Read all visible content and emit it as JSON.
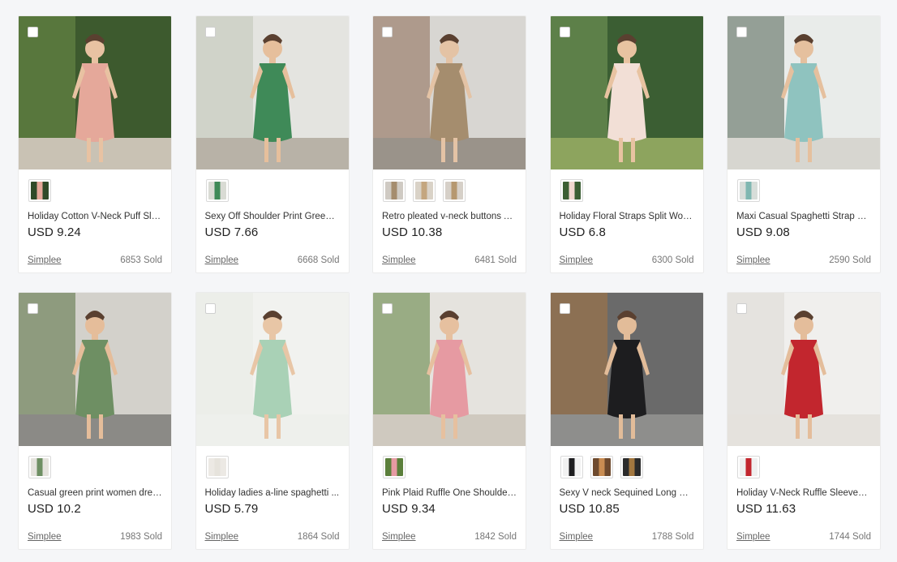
{
  "products": [
    {
      "title": "Holiday Cotton V-Neck Puff Sle...",
      "price": "USD 9.24",
      "store": "Simplee",
      "sold": "6853 Sold",
      "colors": {
        "bg": "#3d5a2e",
        "bg2": "#6f8f4a",
        "ground": "#c9c2b4",
        "dress": "#e5a89a",
        "skin": "#e8c2a2"
      },
      "swatches": [
        {
          "a": "#2f4a28",
          "b": "#e5a89a"
        }
      ]
    },
    {
      "title": "Sexy Off Shoulder Print Green ...",
      "price": "USD 7.66",
      "store": "Simplee",
      "sold": "6668 Sold",
      "colors": {
        "bg": "#e4e4e0",
        "bg2": "#bfc4b6",
        "ground": "#b8b2a7",
        "dress": "#3f8a58",
        "skin": "#e6bf9c"
      },
      "swatches": [
        {
          "a": "#d9dbd4",
          "b": "#3f8a58"
        }
      ]
    },
    {
      "title": "Retro pleated v-neck buttons A...",
      "price": "USD 10.38",
      "store": "Simplee",
      "sold": "6481 Sold",
      "colors": {
        "bg": "#d8d6d2",
        "bg2": "#8c6a52",
        "ground": "#9a938a",
        "dress": "#a58d6e",
        "skin": "#e4c3a5"
      },
      "swatches": [
        {
          "a": "#cfcac3",
          "b": "#a58d6e"
        },
        {
          "a": "#d9d2c7",
          "b": "#c4a67f"
        },
        {
          "a": "#d6d0c8",
          "b": "#b69870"
        }
      ]
    },
    {
      "title": "Holiday Floral Straps Split Wom...",
      "price": "USD 6.8",
      "store": "Simplee",
      "sold": "6300 Sold",
      "colors": {
        "bg": "#3b5e33",
        "bg2": "#7a9c5b",
        "ground": "#8da45e",
        "dress": "#f2dfd6",
        "skin": "#e8c3a1"
      },
      "swatches": [
        {
          "a": "#3b5e33",
          "b": "#f0d7cf"
        }
      ]
    },
    {
      "title": "Maxi Casual Spaghetti Strap Cr...",
      "price": "USD 9.08",
      "store": "Simplee",
      "sold": "2590 Sold",
      "colors": {
        "bg": "#e9ecea",
        "bg2": "#4f6150",
        "ground": "#d7d6d0",
        "dress": "#8fc3bf",
        "skin": "#e5c09e"
      },
      "swatches": [
        {
          "a": "#d7ddd9",
          "b": "#7fb7b1"
        }
      ]
    },
    {
      "title": "Casual green print women dres...",
      "price": "USD 10.2",
      "store": "Simplee",
      "sold": "1983 Sold",
      "colors": {
        "bg": "#d3d1cb",
        "bg2": "#55703f",
        "ground": "#8b8a86",
        "dress": "#6e8f63",
        "skin": "#e5bd9a"
      },
      "swatches": [
        {
          "a": "#e4e2dc",
          "b": "#6e8f63"
        }
      ]
    },
    {
      "title": "Holiday ladies a-line spaghetti ...",
      "price": "USD 5.79",
      "store": "Simplee",
      "sold": "1864 Sold",
      "colors": {
        "bg": "#f1f2ef",
        "bg2": "#e7ebe4",
        "ground": "#eef0ec",
        "dress": "#a9d1b6",
        "skin": "#e8c6a6"
      },
      "swatches": [
        {
          "a": "#ece9e4",
          "b": "#e6e3dc"
        }
      ]
    },
    {
      "title": "Pink Plaid Ruffle One Shoulder ...",
      "price": "USD 9.34",
      "store": "Simplee",
      "sold": "1842 Sold",
      "colors": {
        "bg": "#e5e3de",
        "bg2": "#5b7f3b",
        "ground": "#cfc9bf",
        "dress": "#e69aa2",
        "skin": "#e6c09f"
      },
      "swatches": [
        {
          "a": "#5b7f3b",
          "b": "#e69aa2"
        }
      ]
    },
    {
      "title": "Sexy V neck Sequined Long Dre...",
      "price": "USD 10.85",
      "store": "Simplee",
      "sold": "1788 Sold",
      "colors": {
        "bg": "#6a6a6a",
        "bg2": "#a8743f",
        "ground": "#8e8e8c",
        "dress": "#1d1d1f",
        "skin": "#e2bc99"
      },
      "swatches": [
        {
          "a": "#f1f1f1",
          "b": "#1d1d1f"
        },
        {
          "a": "#6e4a2e",
          "b": "#c98d52"
        },
        {
          "a": "#2b2b2b",
          "b": "#a2773f"
        }
      ]
    },
    {
      "title": "Holiday V-Neck Ruffle Sleeves L...",
      "price": "USD 11.63",
      "store": "Simplee",
      "sold": "1744 Sold",
      "colors": {
        "bg": "#f0efed",
        "bg2": "#dcd9d4",
        "ground": "#e5e2dd",
        "dress": "#c2262e",
        "skin": "#e4bd9b"
      },
      "swatches": [
        {
          "a": "#efefef",
          "b": "#c2262e"
        }
      ]
    }
  ]
}
